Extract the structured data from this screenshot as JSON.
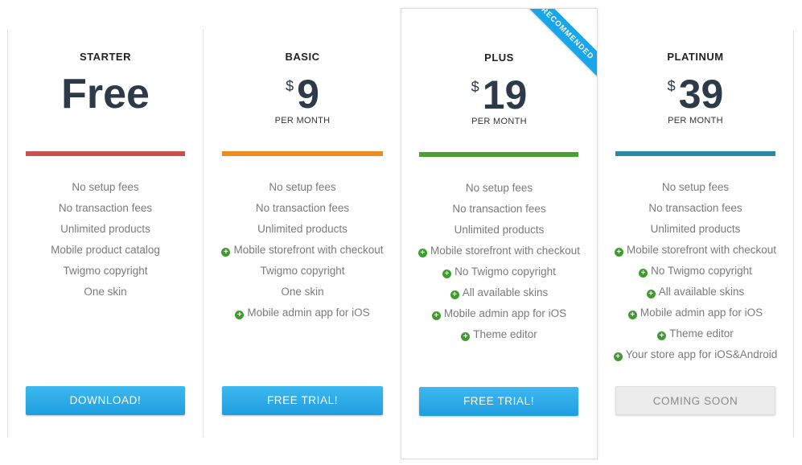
{
  "plans": [
    {
      "name": "STARTER",
      "price": "Free",
      "bar_color": "#c9504f",
      "features": [
        {
          "text": "No setup fees",
          "plus": false
        },
        {
          "text": "No transaction fees",
          "plus": false
        },
        {
          "text": "Unlimited products",
          "plus": false
        },
        {
          "text": "Mobile product catalog",
          "plus": false
        },
        {
          "text": "Twigmo copyright",
          "plus": false
        },
        {
          "text": "One skin",
          "plus": false
        }
      ],
      "button": "DOWNLOAD!",
      "button_style": "blue"
    },
    {
      "name": "BASIC",
      "currency": "$",
      "amount": "9",
      "period": "PER MONTH",
      "bar_color": "#ef8c1f",
      "features": [
        {
          "text": "No setup fees",
          "plus": false
        },
        {
          "text": "No transaction fees",
          "plus": false
        },
        {
          "text": "Unlimited products",
          "plus": false
        },
        {
          "text": "Mobile storefront with checkout",
          "plus": true
        },
        {
          "text": "Twigmo copyright",
          "plus": false
        },
        {
          "text": "One skin",
          "plus": false
        },
        {
          "text": "Mobile admin app for iOS",
          "plus": true
        }
      ],
      "button": "FREE TRIAL!",
      "button_style": "blue"
    },
    {
      "name": "PLUS",
      "currency": "$",
      "amount": "19",
      "period": "PER MONTH",
      "bar_color": "#4aa12f",
      "ribbon": "RECOMMENDED",
      "features": [
        {
          "text": "No setup fees",
          "plus": false
        },
        {
          "text": "No transaction fees",
          "plus": false
        },
        {
          "text": "Unlimited products",
          "plus": false
        },
        {
          "text": "Mobile storefront with checkout",
          "plus": true
        },
        {
          "text": "No Twigmo copyright",
          "plus": true
        },
        {
          "text": "All available skins",
          "plus": true
        },
        {
          "text": "Mobile admin app for iOS",
          "plus": true
        },
        {
          "text": "Theme editor",
          "plus": true
        }
      ],
      "button": "FREE TRIAL!",
      "button_style": "blue"
    },
    {
      "name": "PLATINUM",
      "currency": "$",
      "amount": "39",
      "period": "PER MONTH",
      "bar_color": "#2b88a6",
      "features": [
        {
          "text": "No setup fees",
          "plus": false
        },
        {
          "text": "No transaction fees",
          "plus": false
        },
        {
          "text": "Unlimited products",
          "plus": false
        },
        {
          "text": "Mobile storefront with checkout",
          "plus": true
        },
        {
          "text": "No Twigmo copyright",
          "plus": true
        },
        {
          "text": "All available skins",
          "plus": true
        },
        {
          "text": "Mobile admin app for iOS",
          "plus": true
        },
        {
          "text": "Theme editor",
          "plus": true
        },
        {
          "text": "Your store app for iOS&Android",
          "plus": true
        }
      ],
      "button": "COMING SOON",
      "button_style": "gray"
    }
  ],
  "icons": {
    "feature_plus": "plus-circle-icon"
  }
}
